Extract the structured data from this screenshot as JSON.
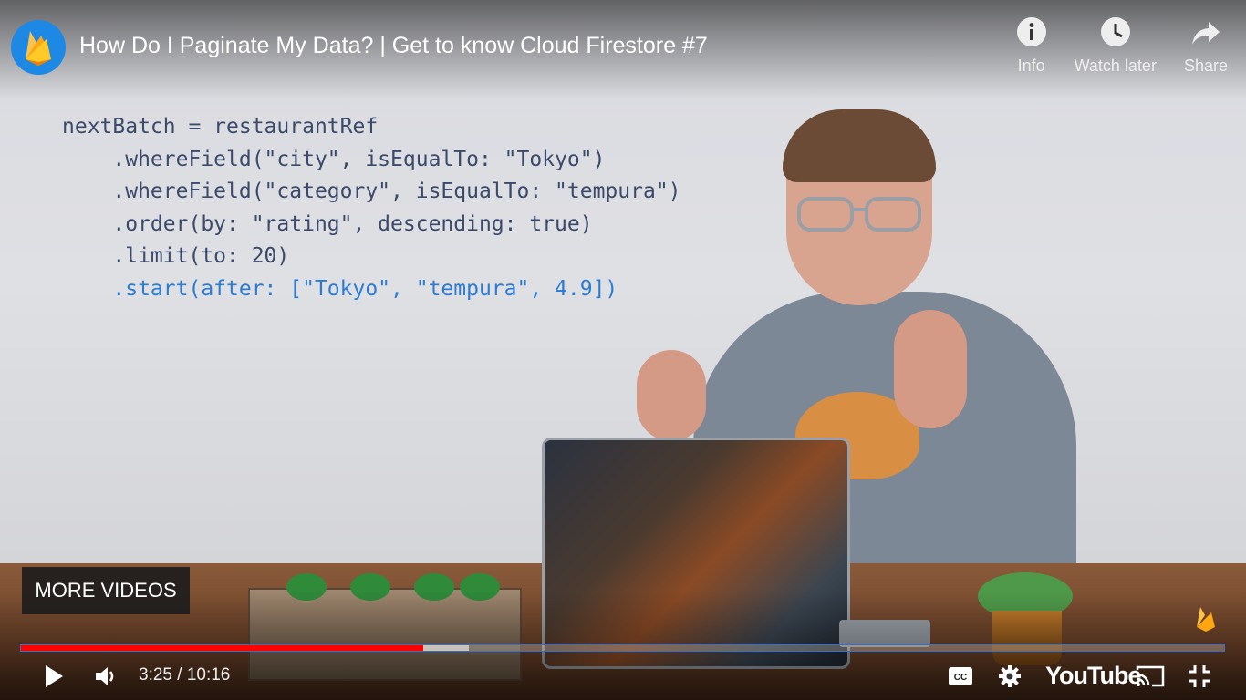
{
  "video": {
    "title": "How Do I Paginate My Data? | Get to know Cloud Firestore #7",
    "channel_icon": "firebase-logo"
  },
  "top_actions": [
    {
      "icon": "info-icon",
      "label": "Info"
    },
    {
      "icon": "clock-icon",
      "label": "Watch later"
    },
    {
      "icon": "share-arrow-icon",
      "label": "Share"
    }
  ],
  "code": {
    "lines": [
      "nextBatch = restaurantRef",
      "    .whereField(\"city\", isEqualTo: \"Tokyo\")",
      "    .whereField(\"category\", isEqualTo: \"tempura\")",
      "    .order(by: \"rating\", descending: true)",
      "    .limit(to: 20)",
      "    .start(after: [\"Tokyo\", \"tempura\", 4.9])"
    ]
  },
  "more_videos_label": "MORE VIDEOS",
  "player": {
    "current_time": "3:25",
    "duration": "10:16",
    "time_display": "3:25 / 10:16",
    "played_fraction": 0.334,
    "loaded_fraction": 0.372,
    "brand": "YouTube",
    "colors": {
      "progress_played": "#ff0000",
      "code_text": "#3b4a6b",
      "code_highlight": "#2b7bd3"
    }
  },
  "controls": [
    "play-icon",
    "volume-icon",
    "captions-icon",
    "settings-icon",
    "youtube-logo",
    "cast-icon",
    "exit-fullscreen-icon"
  ]
}
